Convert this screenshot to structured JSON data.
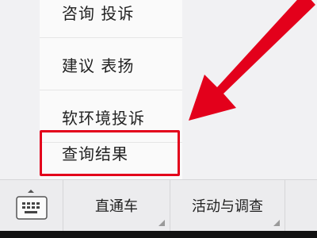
{
  "menu": {
    "items": [
      {
        "label": "咨询  投诉"
      },
      {
        "label": "建议  表扬"
      },
      {
        "label": "软环境投诉"
      },
      {
        "label": "查询结果"
      }
    ]
  },
  "tabbar": {
    "tabs": [
      {
        "label": "直通车"
      },
      {
        "label": "活动与调查"
      },
      {
        "label": ""
      }
    ]
  },
  "icons": {
    "keyboard": "keyboard-icon",
    "expand": "chevron-up-icon",
    "submenu": "corner-triangle-icon"
  },
  "colors": {
    "highlight": "#e3001b",
    "arrow": "#e3001b",
    "menu_bg": "#fafafa",
    "tabbar_bg": "#ececee"
  }
}
